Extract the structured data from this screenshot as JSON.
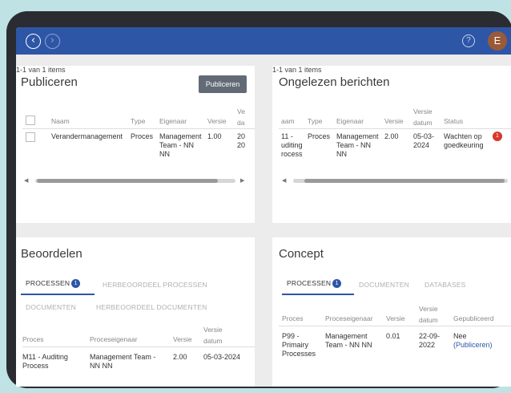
{
  "colors": {
    "topbar": "#2e56a6",
    "primary_button": "#626a76",
    "badge": "#2e56a6",
    "status_alert": "#d9372b"
  },
  "topbar": {
    "back_icon": "chevron-left-icon",
    "forward_icon": "chevron-right-icon",
    "help_label": "?",
    "avatar_initial": "E"
  },
  "publiceren": {
    "title": "Publiceren",
    "button": "Publiceren",
    "columns": [
      "Naam",
      "Type",
      "Eigenaar",
      "Versie",
      "Ve\nda"
    ],
    "row": {
      "naam": "Verandermanagement",
      "type": "Proces",
      "eigenaar": "Management\nTeam - NN\nNN",
      "versie": "1.00",
      "datum": "20\n20"
    },
    "pager": "1-1 van 1 items"
  },
  "ongelezen": {
    "title": "Ongelezen berichten",
    "columns": [
      "aam",
      "Type",
      "Eigenaar",
      "Versie",
      "Versie\ndatum",
      "Status"
    ],
    "row": {
      "naam": "11 -\nuditing\nrocess",
      "type": "Proces",
      "eigenaar": "Management\nTeam - NN\nNN",
      "versie": "2.00",
      "datum": "05-03-\n2024",
      "status": "Wachten op\ngoedkeuring",
      "status_count": "1"
    },
    "pager": "1-1 van 1 items"
  },
  "beoordelen": {
    "title": "Beoordelen",
    "tabs": [
      {
        "label": "PROCESSEN",
        "count": "1"
      },
      {
        "label": "HERBEOORDEEL PROCESSEN"
      },
      {
        "label": "DOCUMENTEN"
      },
      {
        "label": "HERBEOORDEEL DOCUMENTEN"
      }
    ],
    "columns": [
      "Proces",
      "Proceseigenaar",
      "Versie",
      "Versie\ndatum"
    ],
    "row": {
      "proces": "M11 - Auditing\nProcess",
      "eigenaar": "Management Team -\nNN NN",
      "versie": "2.00",
      "datum": "05-03-2024"
    }
  },
  "concept": {
    "title": "Concept",
    "tabs": [
      {
        "label": "PROCESSEN",
        "count": "1"
      },
      {
        "label": "DOCUMENTEN"
      },
      {
        "label": "DATABASES"
      }
    ],
    "columns": [
      "Proces",
      "Proceseigenaar",
      "Versie",
      "Versie\ndatum",
      "Gepubliceerd"
    ],
    "row": {
      "proces": "P99 -\nPrimairy\nProcesses",
      "eigenaar": "Management\nTeam - NN NN",
      "versie": "0.01",
      "datum": "22-09-\n2022",
      "gepubliceerd": "Nee",
      "link": "(Publiceren)"
    }
  }
}
